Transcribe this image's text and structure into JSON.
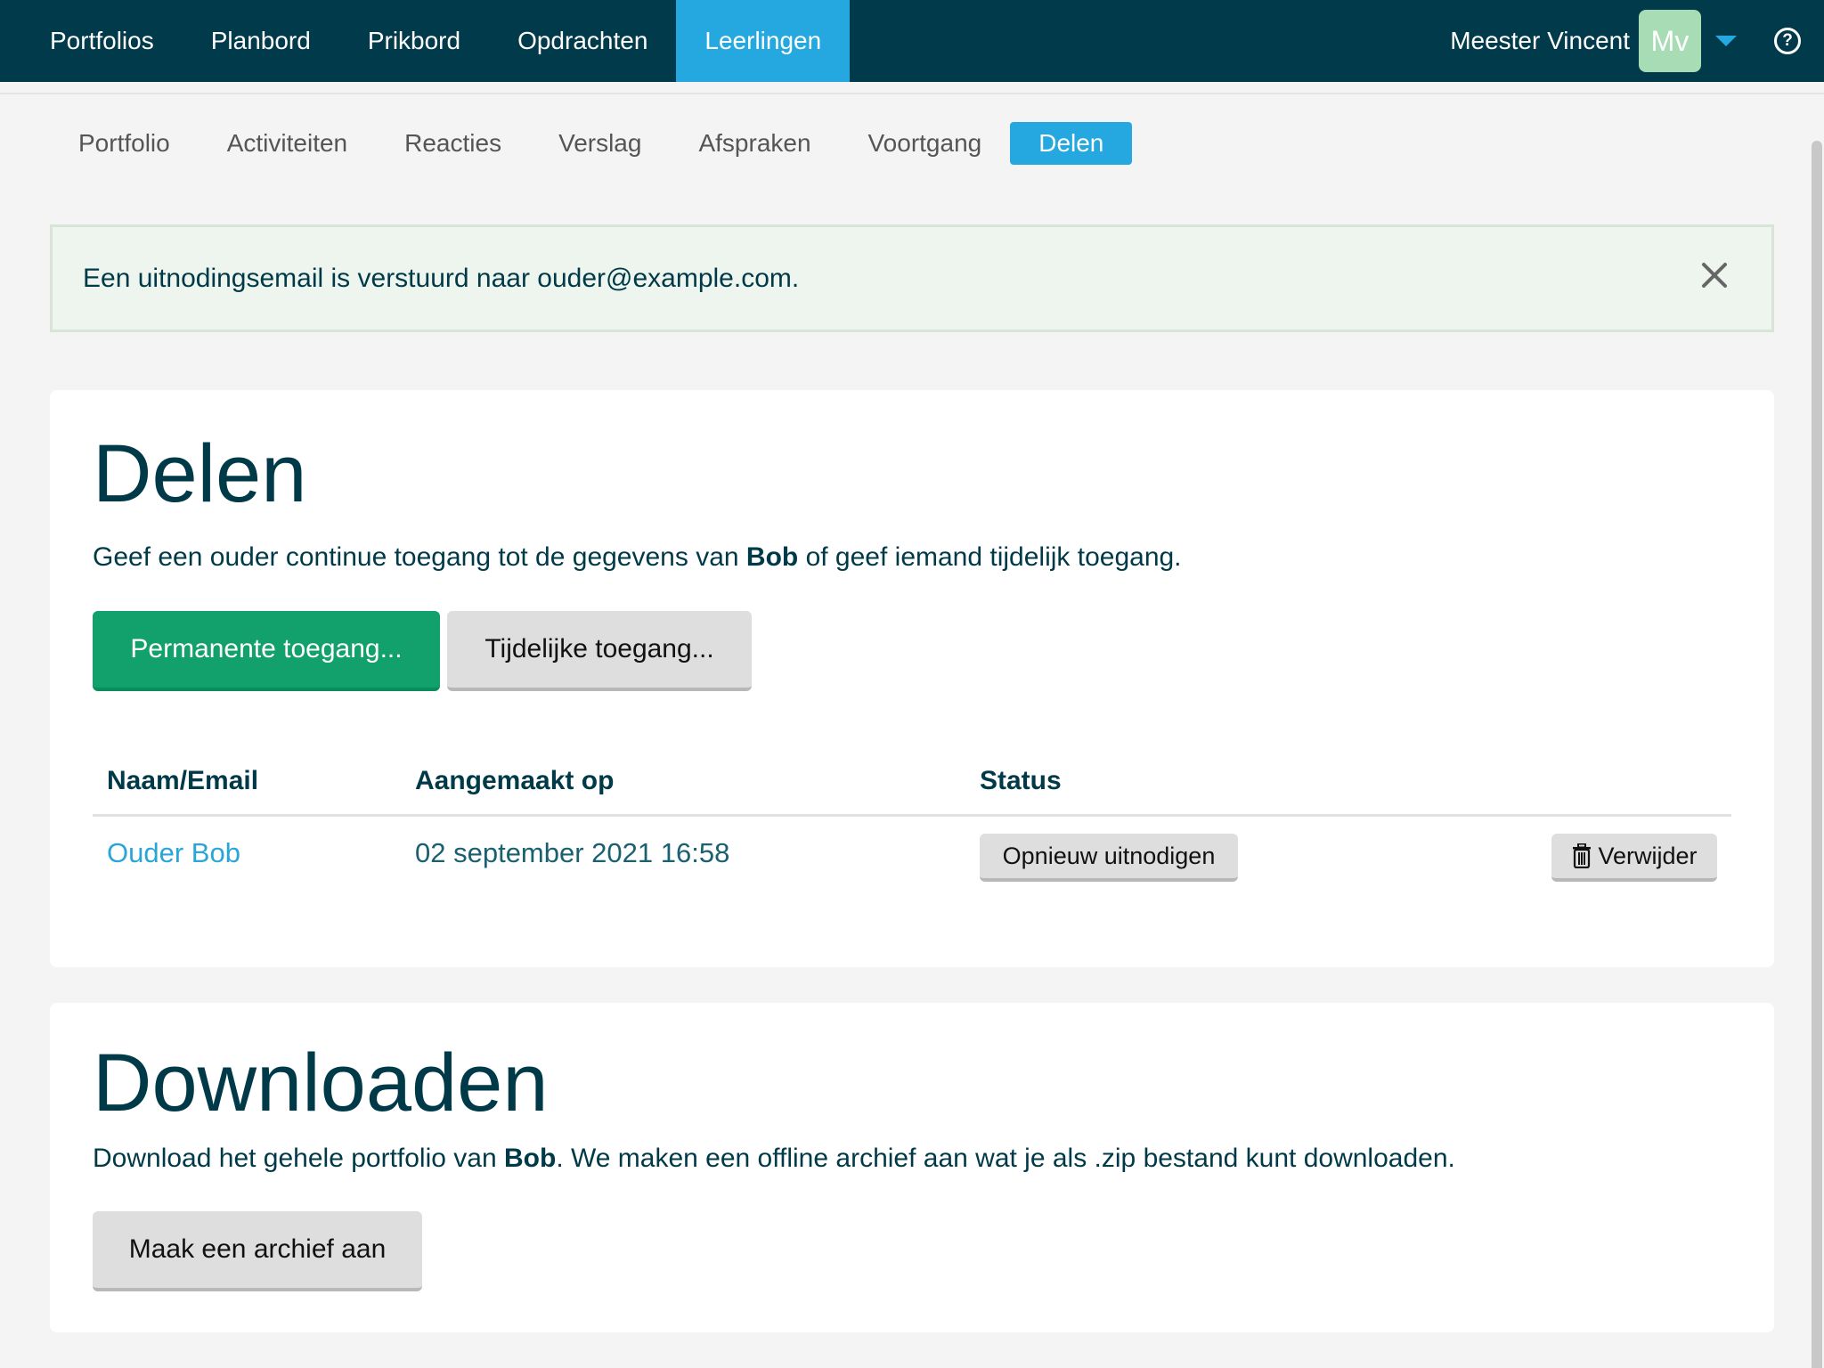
{
  "topnav": {
    "items": [
      {
        "label": "Portfolios"
      },
      {
        "label": "Planbord"
      },
      {
        "label": "Prikbord"
      },
      {
        "label": "Opdrachten"
      },
      {
        "label": "Leerlingen",
        "active": true
      }
    ],
    "user_name": "Meester Vincent",
    "avatar_initials": "Mv",
    "help_symbol": "?"
  },
  "subnav": {
    "tabs": [
      {
        "label": "Portfolio"
      },
      {
        "label": "Activiteiten"
      },
      {
        "label": "Reacties"
      },
      {
        "label": "Verslag"
      },
      {
        "label": "Afspraken"
      },
      {
        "label": "Voortgang"
      },
      {
        "label": "Delen",
        "active": true
      }
    ]
  },
  "alert": {
    "message": "Een uitnodingsemail is verstuurd naar ouder@example.com."
  },
  "share": {
    "title": "Delen",
    "desc_pre": "Geef een ouder continue toegang tot de gegevens van ",
    "student": "Bob",
    "desc_post": " of geef iemand tijdelijk toegang.",
    "btn_permanent": "Permanente toegang...",
    "btn_temporary": "Tijdelijke toegang...",
    "columns": {
      "name": "Naam/Email",
      "created": "Aangemaakt op",
      "status": "Status"
    },
    "rows": [
      {
        "name": "Ouder Bob",
        "created": "02 september 2021 16:58",
        "reinvite": "Opnieuw uitnodigen",
        "delete": "Verwijder"
      }
    ]
  },
  "download": {
    "title": "Downloaden",
    "desc_pre": "Download het gehele portfolio van ",
    "student": "Bob",
    "desc_post": ". We maken een offline archief aan wat je als .zip bestand kunt downloaden.",
    "btn_archive": "Maak een archief aan"
  },
  "colors": {
    "nav_bg": "#013a4a",
    "accent_blue": "#24a8df",
    "green": "#12a06c",
    "text_dark": "#003a48"
  },
  "icons": [
    "help-icon",
    "chevron-down-icon",
    "close-icon",
    "trash-icon"
  ]
}
